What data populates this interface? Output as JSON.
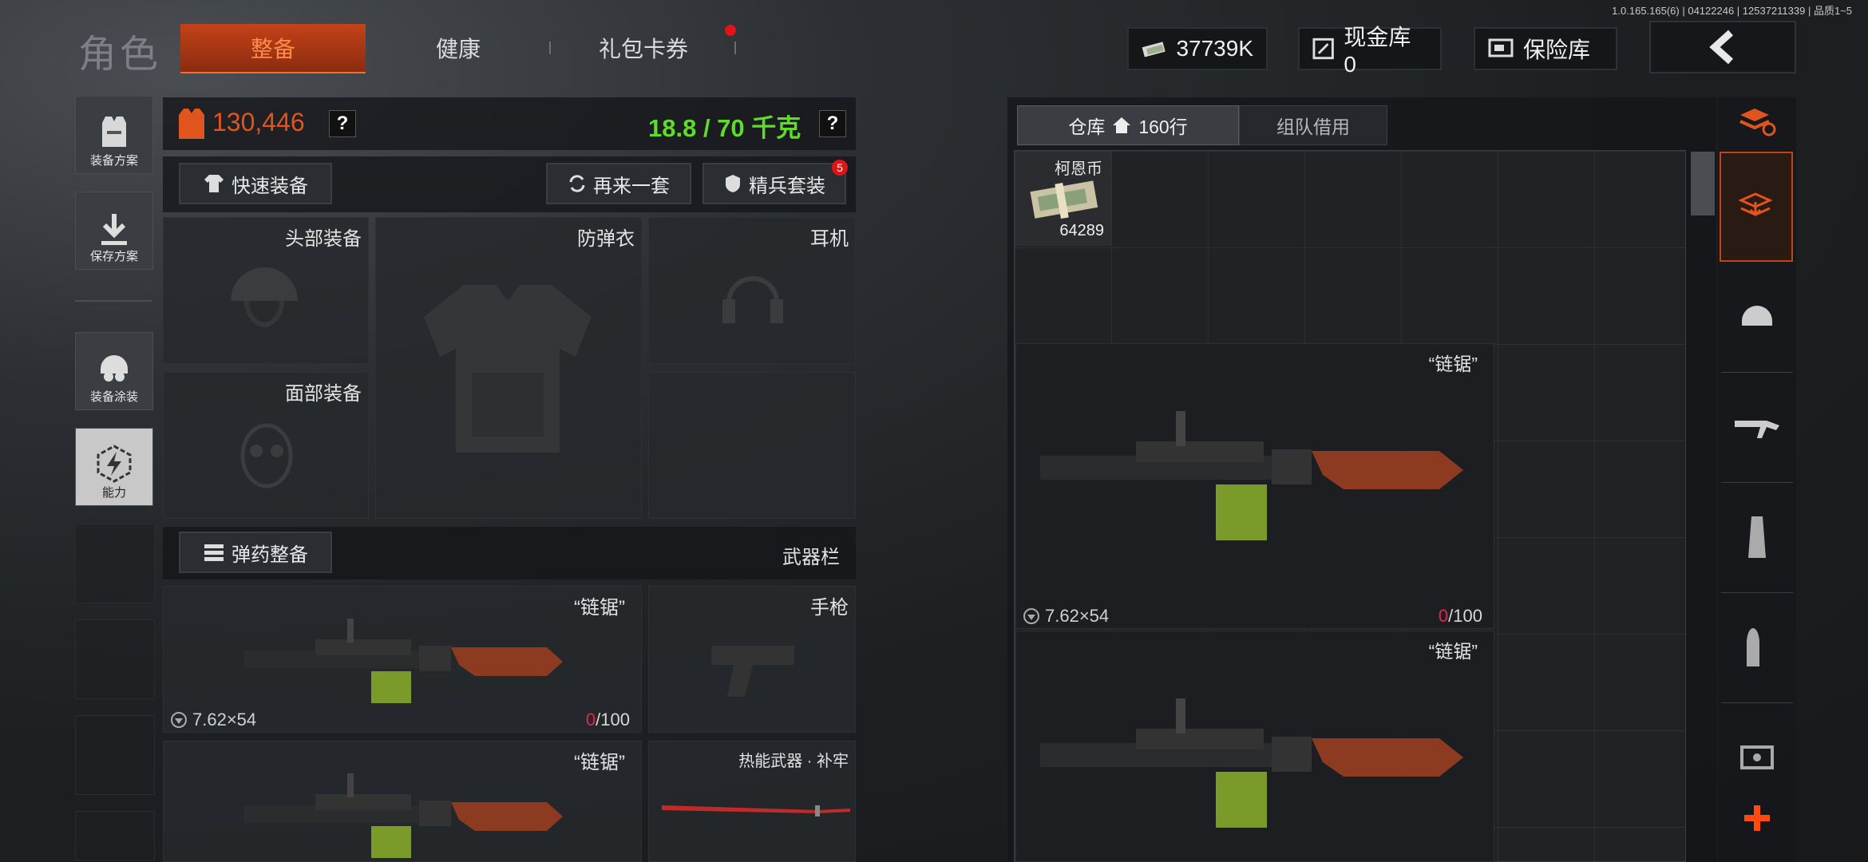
{
  "version": "1.0.165.165(6) | 04122246 | 12537211339 | 品质1~5",
  "page_title": "角色",
  "tabs": [
    {
      "label": "整备",
      "active": true
    },
    {
      "label": "健康",
      "active": false
    },
    {
      "label": "礼包卡券",
      "active": false,
      "has_dot": true
    }
  ],
  "header": {
    "cash_amount": "37739K",
    "cash_vault_label": "现金库 0",
    "safe_label": "保险库"
  },
  "sidebar": [
    {
      "label": "装备方案",
      "icon": "vest-icon"
    },
    {
      "label": "保存方案",
      "icon": "download-icon"
    },
    {
      "label": "装备涂装",
      "icon": "helmet-paint-icon"
    },
    {
      "label": "能力",
      "icon": "lightning-icon",
      "active": true
    }
  ],
  "loadout": {
    "value": "130,446",
    "weight": "18.8 / 70 千克",
    "quick_equip_label": "快速装备",
    "retry_label": "再来一套",
    "elite_label": "精兵套装",
    "elite_badge": "5",
    "slots": {
      "head": "头部装备",
      "armor": "防弹衣",
      "headset": "耳机",
      "face": "面部装备"
    },
    "ammo_label": "弹药整备",
    "weapon_bar_label": "武器栏",
    "weapon1": {
      "name": "“链锯”",
      "caliber": "7.62×54",
      "ammo_current": "0",
      "ammo_max": "/100"
    },
    "pistol_label": "手枪",
    "weapon2": {
      "name": "“链锯”"
    },
    "melee_label": "热能武器 · 补牢"
  },
  "storage": {
    "tab_warehouse": "仓库",
    "rows": "160行",
    "tab_team": "组队借用",
    "currency_name": "柯恩币",
    "currency_amount": "64289",
    "item1": {
      "name": "“链锯”",
      "caliber": "7.62×54",
      "ammo_current": "0",
      "ammo_max": "/100"
    },
    "item2": {
      "name": "“链锯”"
    }
  },
  "colors": {
    "accent": "#e0541e",
    "weight_green": "#5fdc2a",
    "ammo_red": "#e0284a"
  }
}
